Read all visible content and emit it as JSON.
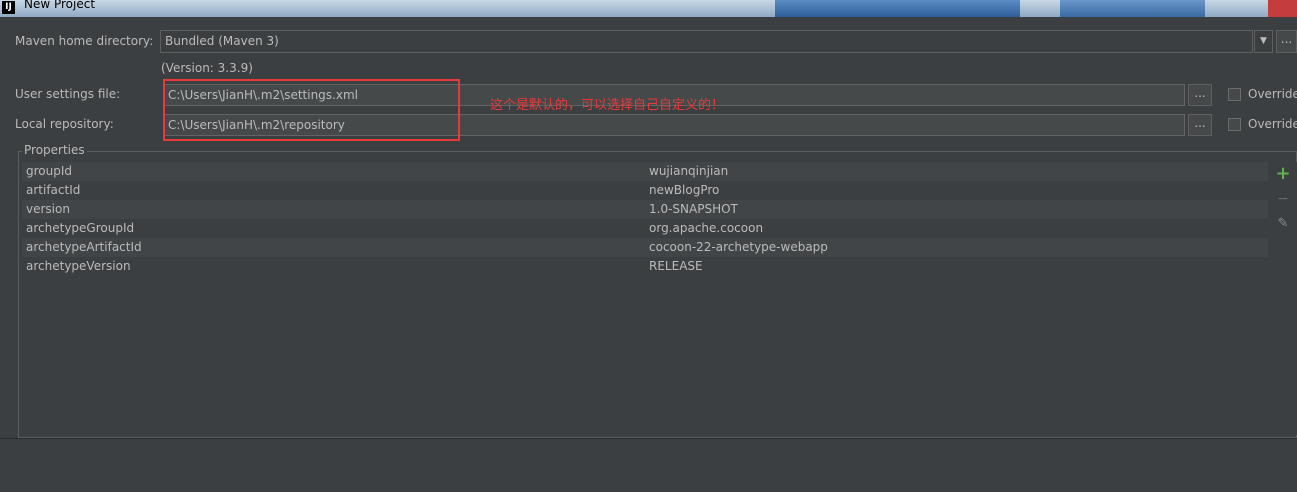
{
  "window": {
    "title": "New Project"
  },
  "maven": {
    "home_label": "Maven home directory:",
    "home_value": "Bundled (Maven 3)",
    "version_note": "(Version: 3.3.9)",
    "settings_label": "User settings file:",
    "settings_value": "C:\\Users\\JianH\\.m2\\settings.xml",
    "repo_label": "Local repository:",
    "repo_value": "C:\\Users\\JianH\\.m2\\repository",
    "override_label": "Override",
    "browse_label": "..."
  },
  "annotation": {
    "text": "这个是默认的，可以选择自己自定义的！",
    "color": "#e83a3a"
  },
  "properties": {
    "title": "Properties",
    "rows": [
      {
        "key": "groupId",
        "value": "wujianqinjian"
      },
      {
        "key": "artifactId",
        "value": "newBlogPro"
      },
      {
        "key": "version",
        "value": "1.0-SNAPSHOT"
      },
      {
        "key": "archetypeGroupId",
        "value": "org.apache.cocoon"
      },
      {
        "key": "archetypeArtifactId",
        "value": "cocoon-22-archetype-webapp"
      },
      {
        "key": "archetypeVersion",
        "value": "RELEASE"
      }
    ],
    "tools": {
      "add": "+",
      "remove": "−",
      "edit": "✎"
    }
  },
  "colors": {
    "accent_add": "#5fb04f",
    "background": "#3c3f41"
  }
}
